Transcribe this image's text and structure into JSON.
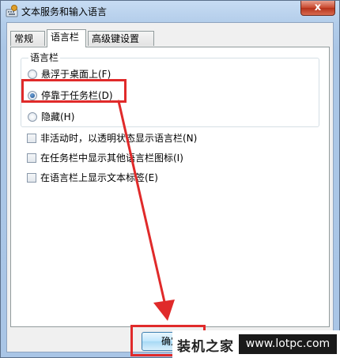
{
  "window": {
    "title": "文本服务和输入语言",
    "close_label": "x"
  },
  "tabs": [
    {
      "label": "常规"
    },
    {
      "label": "语言栏"
    },
    {
      "label": "高级键设置"
    }
  ],
  "language_bar": {
    "group_label": "语言栏",
    "options": [
      {
        "label": "悬浮于桌面上(F)",
        "checked": false
      },
      {
        "label": "停靠于任务栏(D)",
        "checked": true
      },
      {
        "label": "隐藏(H)",
        "checked": false
      }
    ],
    "checkboxes": [
      {
        "label": "非活动时，以透明状态显示语言栏(N)",
        "checked": false
      },
      {
        "label": "在任务栏中显示其他语言栏图标(I)",
        "checked": false
      },
      {
        "label": "在语言栏上显示文本标签(E)",
        "checked": false
      }
    ]
  },
  "footer": {
    "ok_label": "确定"
  },
  "watermark": {
    "logo": "装机之家",
    "url": "www.lotpc.com"
  },
  "colors": {
    "annotation_red": "#e02a2a",
    "titlebar_blue": "#b3cdea"
  },
  "annotations": {
    "highlighted_option": "停靠于任务栏(D)",
    "highlighted_button": "确定"
  }
}
